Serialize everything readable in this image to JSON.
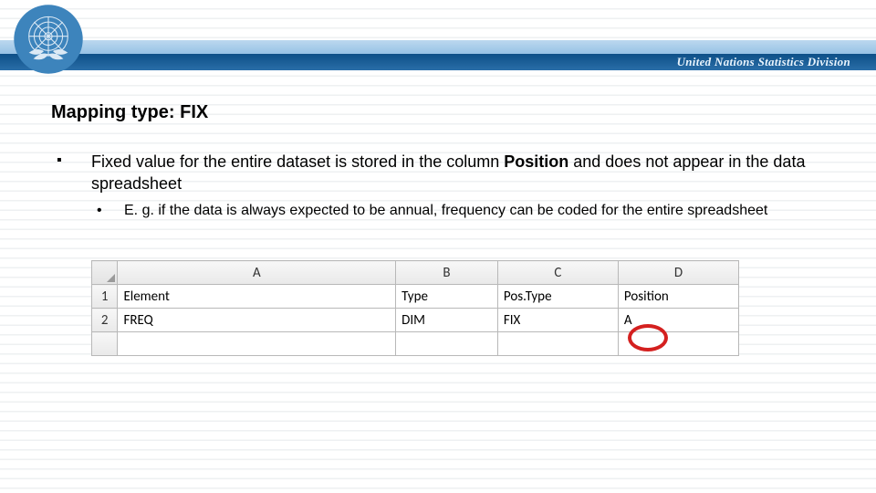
{
  "header": {
    "org_title": "United Nations Statistics Division"
  },
  "slide": {
    "title": "Mapping type: FIX",
    "bullet_pre": "Fixed value for the entire dataset is stored in the column ",
    "bullet_bold": "Position",
    "bullet_post": " and does not appear in the data spreadsheet",
    "sub_bullet": "E. g. if the data is always expected to be annual, frequency can be coded for the entire spreadsheet"
  },
  "sheet": {
    "cols": {
      "a": "A",
      "b": "B",
      "c": "C",
      "d": "D"
    },
    "rows": {
      "r1": "1",
      "r2": "2"
    },
    "r1": {
      "a": "Element",
      "b": "Type",
      "c": "Pos.Type",
      "d": "Position"
    },
    "r2": {
      "a": "FREQ",
      "b": "DIM",
      "c": "FIX",
      "d": "A"
    }
  }
}
